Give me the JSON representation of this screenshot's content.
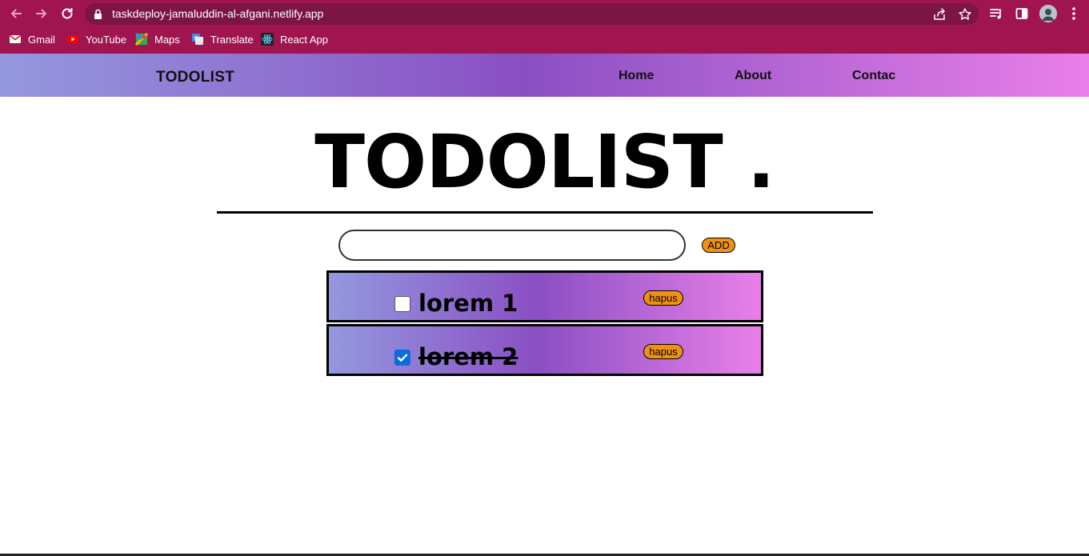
{
  "browser": {
    "url": "taskdeploy-jamaluddin-al-afgani.netlify.app",
    "bookmarks": [
      {
        "label": "Gmail",
        "icon": "gmail-icon"
      },
      {
        "label": "YouTube",
        "icon": "youtube-icon"
      },
      {
        "label": "Maps",
        "icon": "maps-icon"
      },
      {
        "label": "Translate",
        "icon": "translate-icon"
      },
      {
        "label": "React App",
        "icon": "react-icon"
      }
    ]
  },
  "navbar": {
    "brand": "TODOLIST",
    "links": [
      "Home",
      "About",
      "Contac"
    ]
  },
  "main": {
    "title": "TODOLIST .",
    "input": {
      "value": "",
      "placeholder": ""
    },
    "add_label": "ADD",
    "todos": [
      {
        "text": "lorem 1",
        "done": false,
        "delete_label": "hapus"
      },
      {
        "text": "lorem 2",
        "done": true,
        "delete_label": "hapus"
      }
    ]
  },
  "colors": {
    "chrome": "#a0144f",
    "omnibox": "#7c1543",
    "gradient_start": "#9498df",
    "gradient_mid": "#8a4fc3",
    "gradient_end": "#ea7fe9",
    "button": "#f0920f",
    "checkbox_checked": "#0a6cde"
  }
}
